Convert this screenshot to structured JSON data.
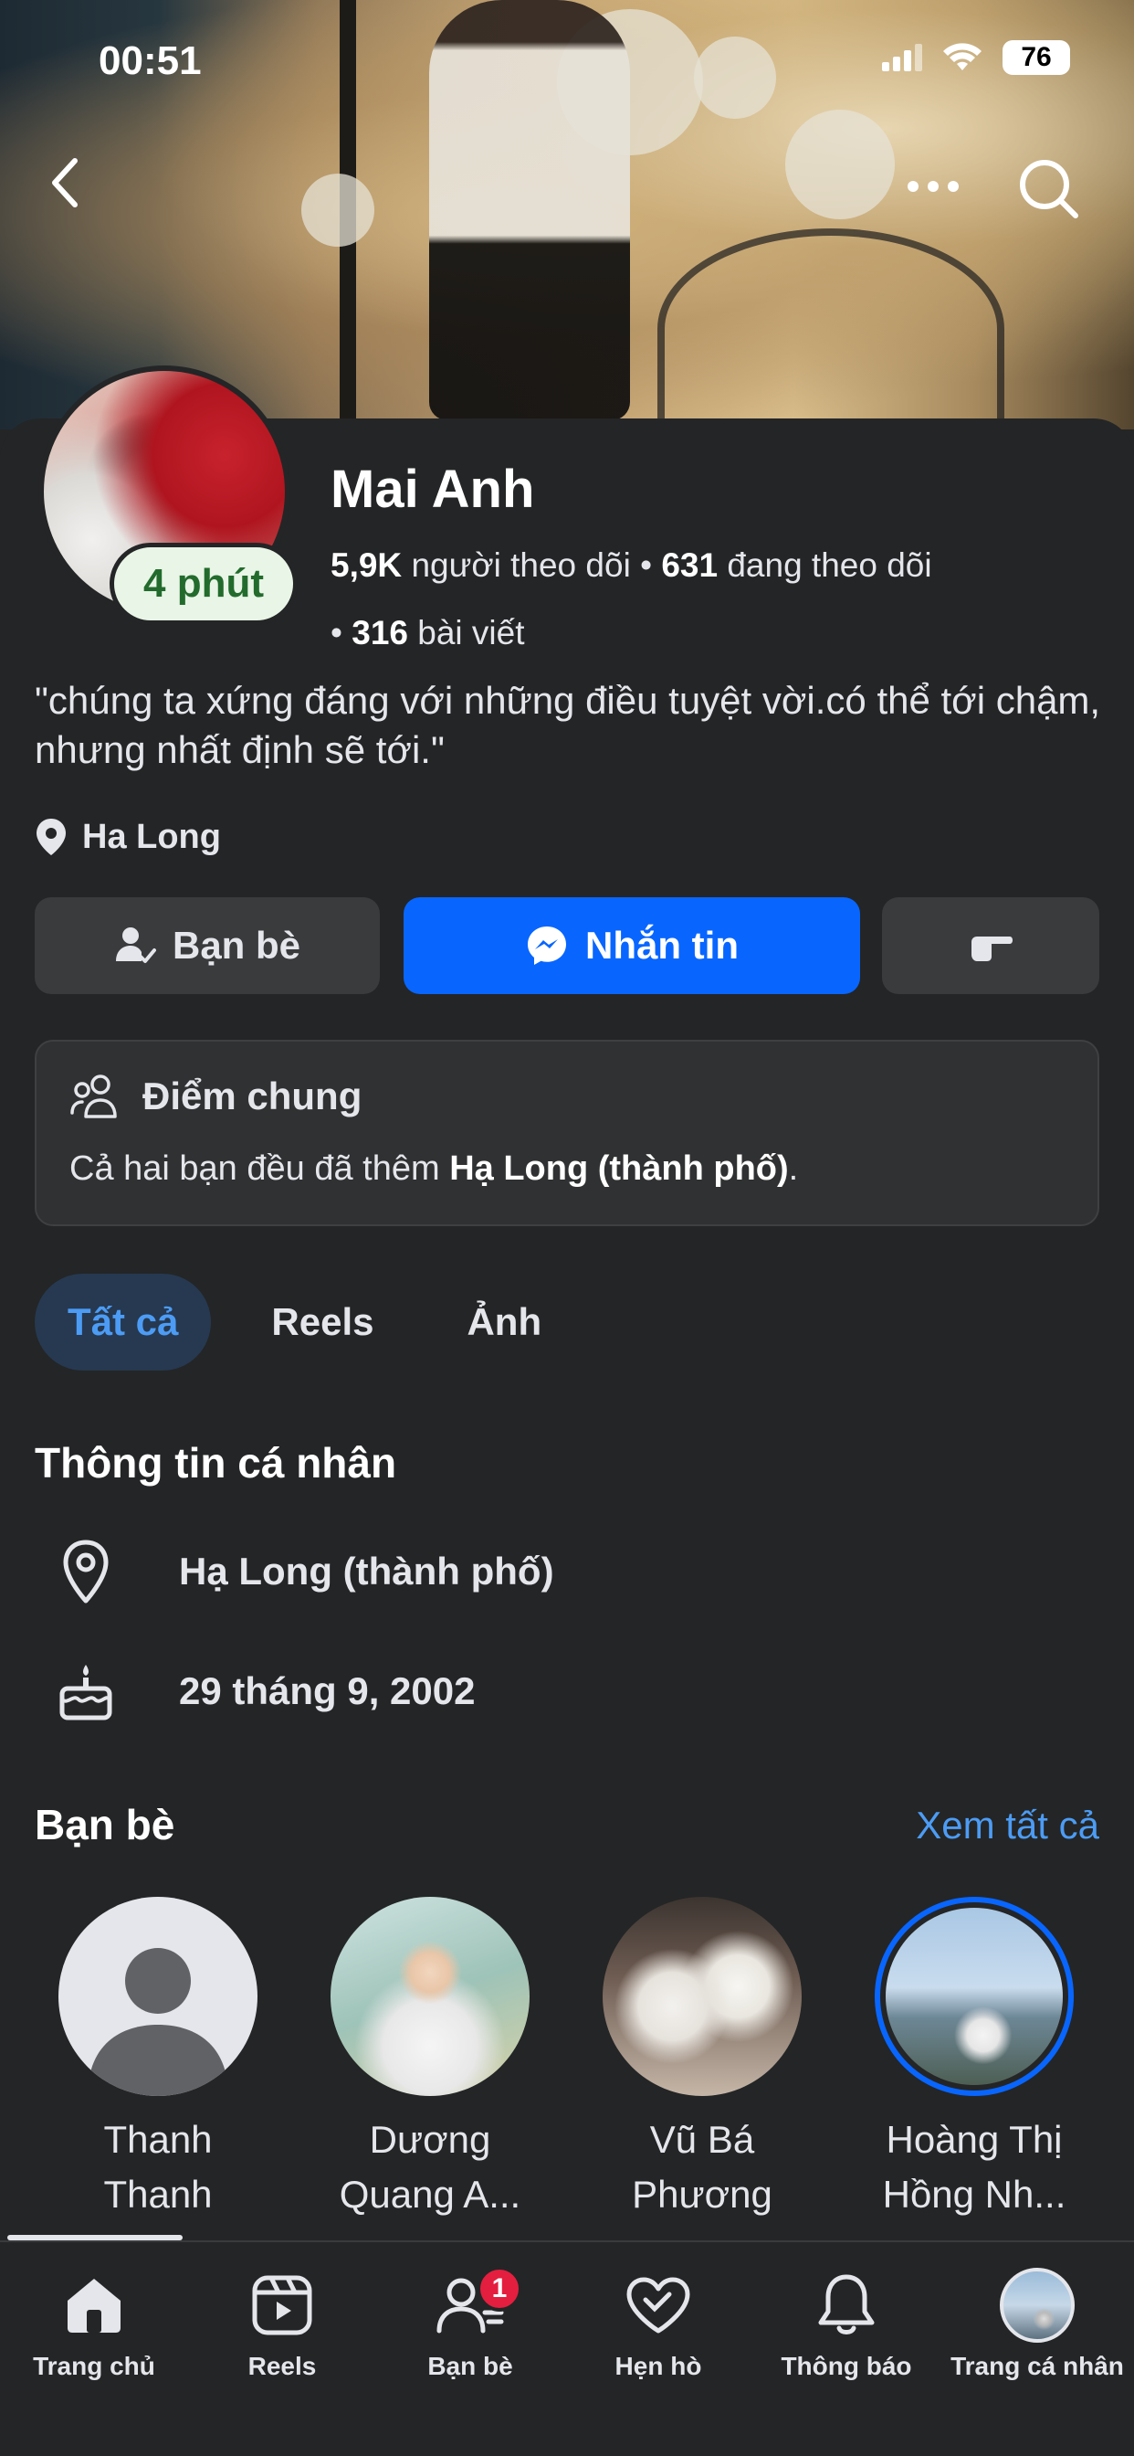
{
  "status_bar": {
    "time": "00:51",
    "battery": "76"
  },
  "profile": {
    "name": "Mai Anh",
    "active_badge": "4 phút",
    "followers_count": "5,9K",
    "followers_label": "người theo dõi",
    "following_count": "631",
    "following_label": "đang theo dõi",
    "posts_count": "316",
    "posts_label": "bài viết",
    "separator": "•",
    "bio": "\"chúng ta xứng đáng với những điều tuyệt vời.có thể tới chậm, nhưng nhất định sẽ tới.\"",
    "location": "Ha Long"
  },
  "actions": {
    "friends_label": "Bạn bè",
    "message_label": "Nhắn tin"
  },
  "common": {
    "title": "Điểm chung",
    "text_prefix": "Cả hai bạn đều đã thêm ",
    "text_bold": "Hạ Long (thành phố)",
    "text_suffix": "."
  },
  "tabs": [
    {
      "label": "Tất cả",
      "active": true
    },
    {
      "label": "Reels",
      "active": false
    },
    {
      "label": "Ảnh",
      "active": false
    }
  ],
  "personal_info": {
    "title": "Thông tin cá nhân",
    "city": "Hạ Long (thành phố)",
    "birthday": "29 tháng 9, 2002"
  },
  "friends": {
    "title": "Bạn bè",
    "see_all": "Xem tất cả",
    "list": [
      {
        "line1": "Thanh",
        "line2": "Thanh"
      },
      {
        "line1": "Dương",
        "line2": "Quang A..."
      },
      {
        "line1": "Vũ Bá",
        "line2": "Phương"
      },
      {
        "line1": "Hoàng Thị",
        "line2": "Hồng Nh..."
      }
    ]
  },
  "bottom_nav": {
    "items": [
      {
        "label": "Trang chủ",
        "icon": "home-icon"
      },
      {
        "label": "Reels",
        "icon": "reels-icon"
      },
      {
        "label": "Bạn bè",
        "icon": "friends-icon",
        "badge": "1"
      },
      {
        "label": "Hẹn hò",
        "icon": "dating-heart-icon"
      },
      {
        "label": "Thông báo",
        "icon": "bell-icon"
      },
      {
        "label": "Trang cá nhân",
        "icon": "profile-avatar-icon"
      }
    ]
  },
  "colors": {
    "background": "#242526",
    "accent": "#0866ff",
    "link": "#4c9cf5",
    "active_badge_bg": "#e9f5e6",
    "active_badge_text": "#226b2d",
    "notification_badge": "#e41e3f"
  }
}
